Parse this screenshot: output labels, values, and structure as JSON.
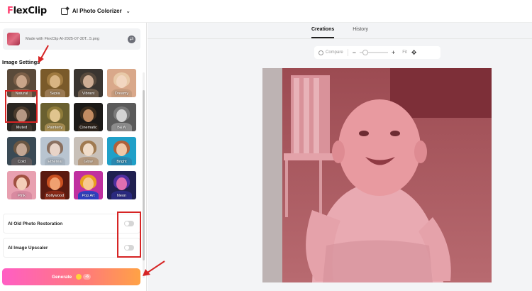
{
  "header": {
    "logo_prefix": "F",
    "logo_rest": "lexClip",
    "tool_name": "AI Photo Colorizer"
  },
  "file": {
    "name": "Made with FlexClip AI-2025-07-30T...5.png"
  },
  "settings": {
    "title": "Image Settings",
    "styles": [
      {
        "label": "Natural",
        "selected": true
      },
      {
        "label": "Sepia",
        "selected": false
      },
      {
        "label": "Vibrant",
        "selected": false
      },
      {
        "label": "Dreamy",
        "selected": false
      },
      {
        "label": "Muted",
        "selected": false
      },
      {
        "label": "Painterly",
        "selected": false
      },
      {
        "label": "Cinematic",
        "selected": false
      },
      {
        "label": "B&W",
        "selected": false
      },
      {
        "label": "Cold",
        "selected": false
      },
      {
        "label": "Ethereal",
        "selected": false
      },
      {
        "label": "Glow",
        "selected": false
      },
      {
        "label": "Bright",
        "selected": false
      },
      {
        "label": "Pink",
        "selected": false
      },
      {
        "label": "Bollywood",
        "selected": false
      },
      {
        "label": "Pop Art",
        "selected": false
      },
      {
        "label": "Neon",
        "selected": false
      }
    ]
  },
  "toggles": {
    "restoration": {
      "label": "AI Old Photo Restoration",
      "on": false
    },
    "upscaler": {
      "label": "AI Image Upscaler",
      "on": false
    }
  },
  "generate": {
    "label": "Generate",
    "cost": "-6"
  },
  "tabs": [
    {
      "label": "Creations",
      "active": true
    },
    {
      "label": "History",
      "active": false
    }
  ],
  "zoom": {
    "compare_label": "Compare",
    "minus": "−",
    "plus": "+",
    "fit_label": "Fit"
  },
  "colors": {
    "accent": "#ff3d6e",
    "annotation": "#d62424",
    "generate_start": "#ff5ec4",
    "generate_end": "#ffa245"
  }
}
